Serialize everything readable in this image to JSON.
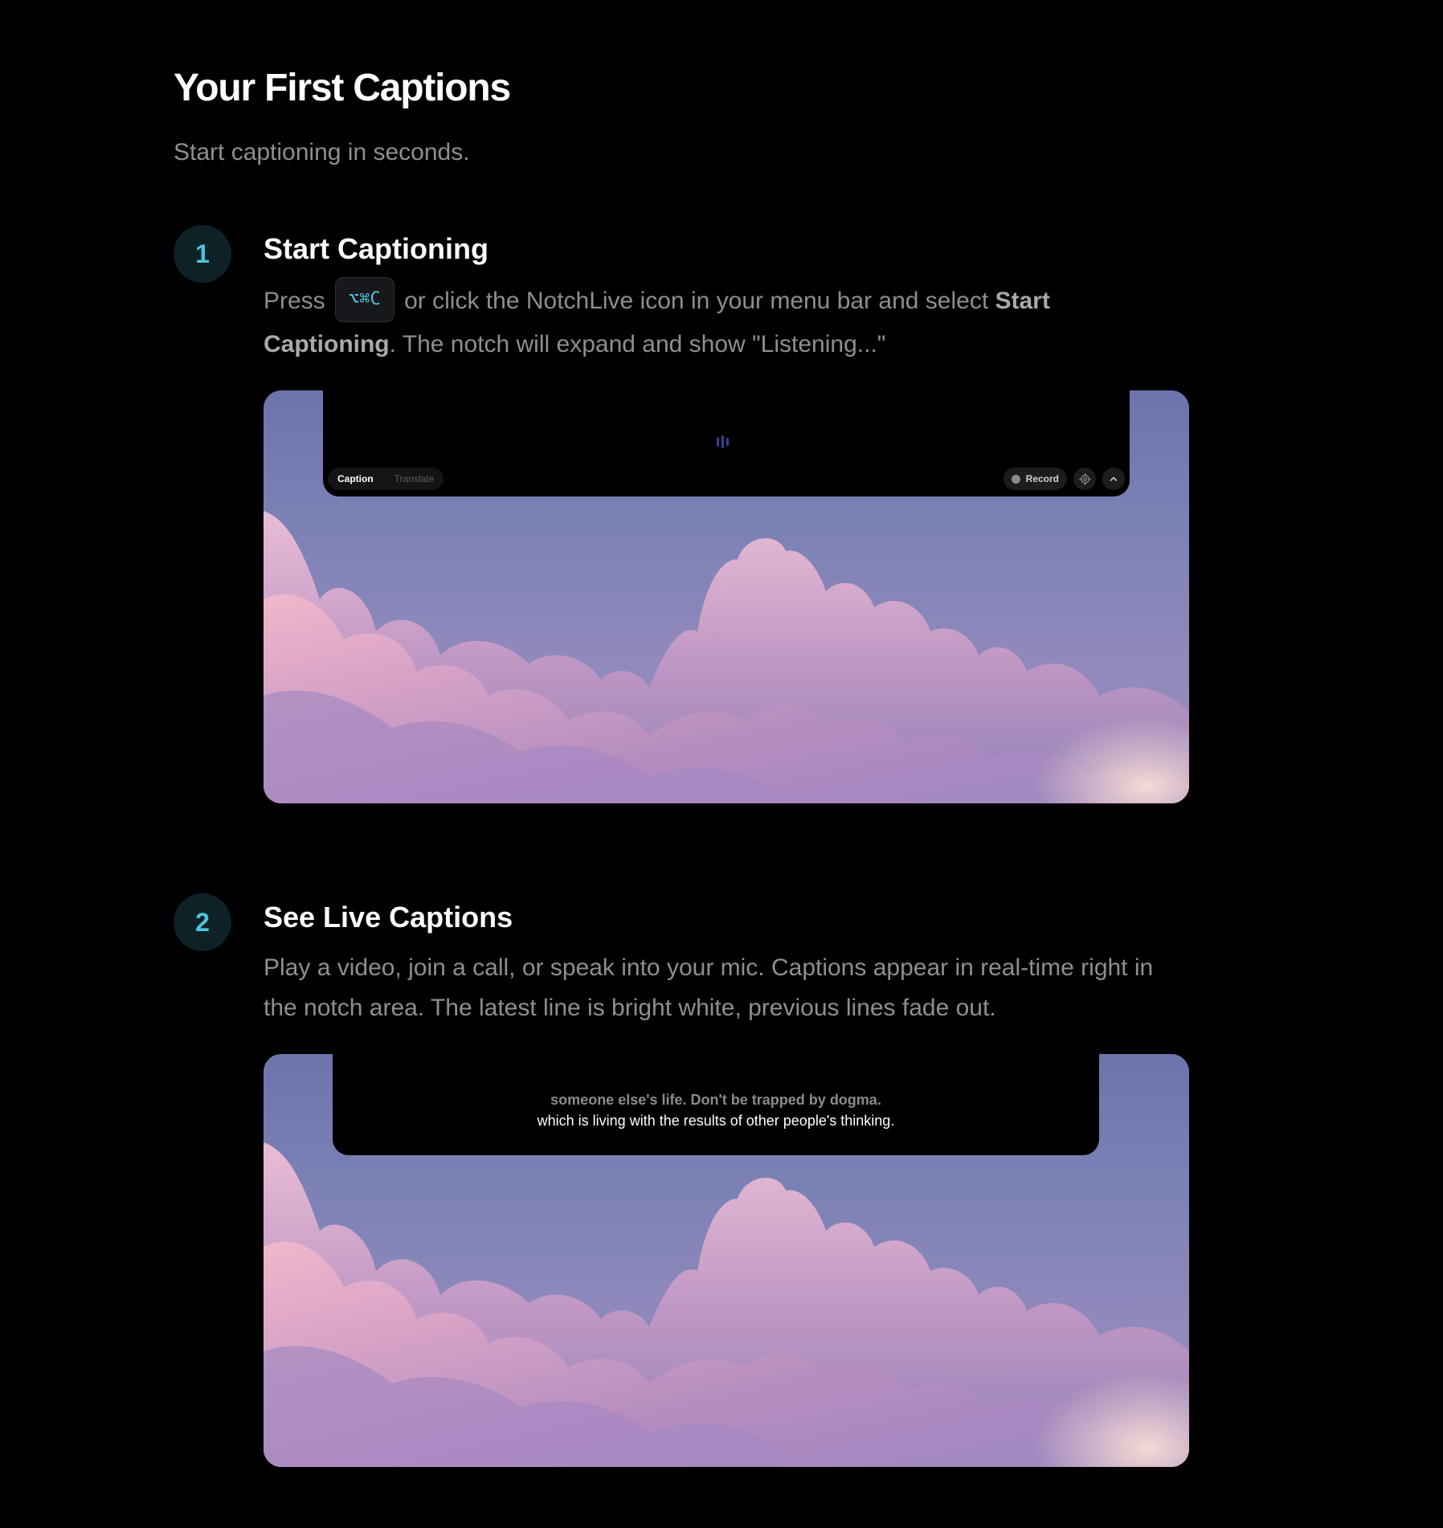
{
  "header": {
    "title": "Your First Captions",
    "subtitle": "Start captioning in seconds."
  },
  "steps": [
    {
      "number": "1",
      "title": "Start Captioning",
      "desc_before": "Press",
      "shortcut": "⌥⌘C",
      "desc_middle": "or click the NotchLive icon in your menu bar and select",
      "desc_bold": "Start Captioning",
      "desc_after": ". The notch will expand and show \"Listening...\"",
      "notch": {
        "mode_active": "Caption",
        "mode_inactive": "Translate",
        "record_label": "Record"
      }
    },
    {
      "number": "2",
      "title": "See Live Captions",
      "desc": "Play a video, join a call, or speak into your mic. Captions appear in real-time right in the notch area. The latest line is bright white, previous lines fade out.",
      "notch": {
        "caption_previous": "someone else's life. Don't be trapped by dogma.",
        "caption_latest": "which is living with the results of other people's thinking."
      }
    }
  ],
  "colors": {
    "background": "#000000",
    "accent": "#4fc3dc",
    "step_badge_bg": "#0d2127",
    "muted_text": "#8e8e93"
  },
  "icons": [
    "waveform-icon",
    "record-dot-icon",
    "gear-icon",
    "chevron-up-icon"
  ]
}
